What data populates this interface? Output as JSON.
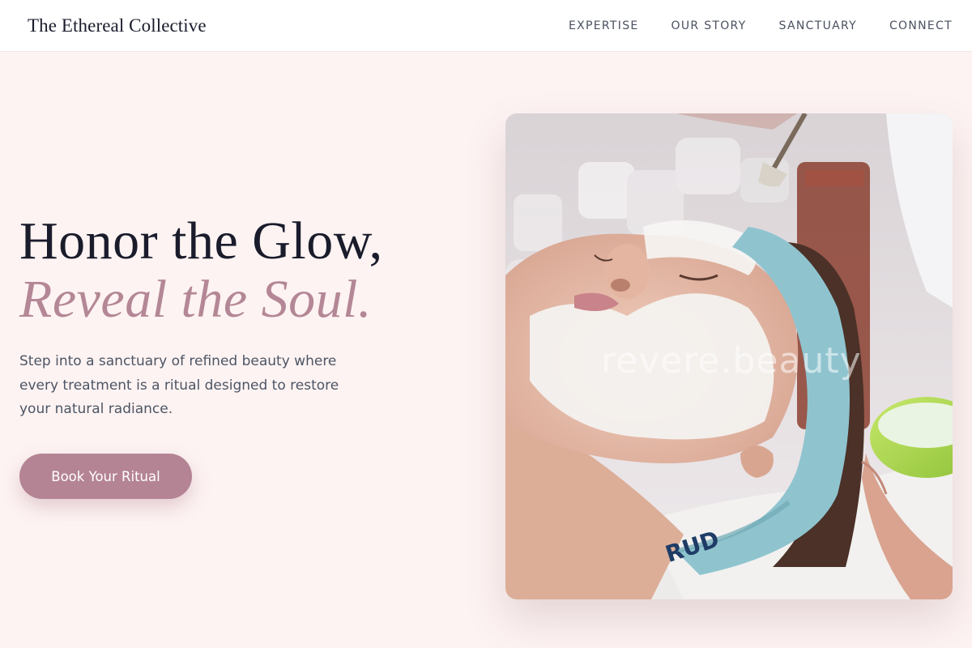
{
  "header": {
    "brand": "The Ethereal Collective",
    "nav": [
      "EXPERTISE",
      "OUR STORY",
      "SANCTUARY",
      "CONNECT"
    ]
  },
  "hero": {
    "headline_line1": "Honor the Glow,",
    "headline_line2": "Reveal the Soul.",
    "description": "Step into a sanctuary of refined beauty where every treatment is a ritual designed to restore your natural radiance.",
    "cta_label": "Book Your Ritual",
    "image": {
      "subject": "facial-treatment-photo",
      "watermark": "revere.beauty",
      "headband_text": "RUD"
    }
  },
  "colors": {
    "page_background": "#fdf3f2",
    "header_background": "#ffffff",
    "headline": "#1a1c2c",
    "accent": "#b48796",
    "body_text": "#4d5565",
    "cta_background": "#b48494"
  }
}
